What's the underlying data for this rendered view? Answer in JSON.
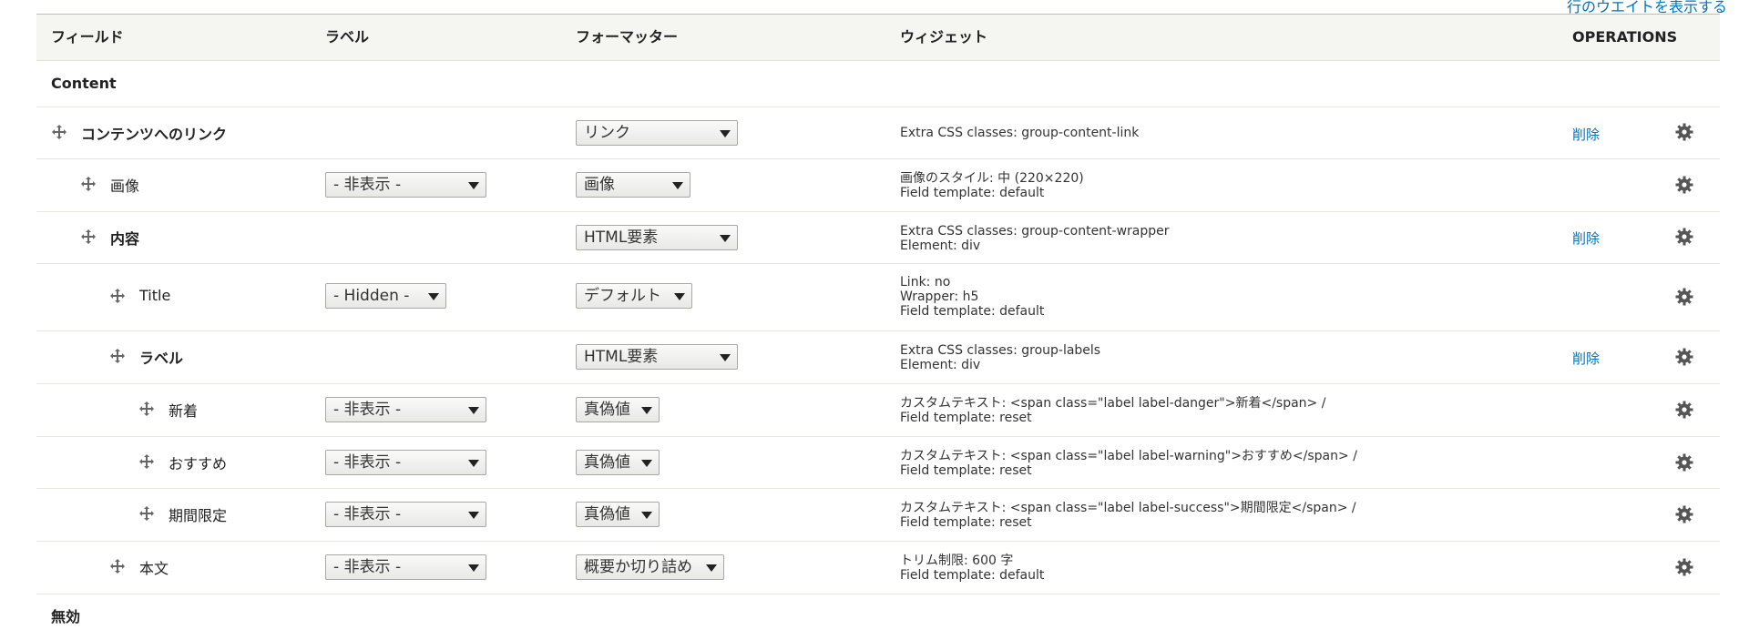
{
  "weights_link": "行のウエイトを表示する",
  "headers": {
    "field": "フィールド",
    "label": "ラベル",
    "formatter": "フォーマッター",
    "widget": "ウィジェット",
    "operations": "OPERATIONS"
  },
  "regions": {
    "content": "Content",
    "disabled": "無効"
  },
  "rows": [
    {
      "name": "コンテンツへのリンク",
      "bold": true,
      "indent": 0,
      "label_select": "",
      "formatter_select": "リンク",
      "widget_lines": [
        "Extra CSS classes: group-content-link"
      ],
      "op": "削除"
    },
    {
      "name": "画像",
      "bold": false,
      "indent": 1,
      "label_select": "- 非表示 -",
      "formatter_select": "画像",
      "widget_lines": [
        "画像のスタイル: 中 (220×220)",
        "Field template: default"
      ],
      "op": ""
    },
    {
      "name": "内容",
      "bold": true,
      "indent": 1,
      "label_select": "",
      "formatter_select": "HTML要素",
      "widget_lines": [
        "Extra CSS classes: group-content-wrapper",
        "Element: div"
      ],
      "op": "削除"
    },
    {
      "name": "Title",
      "bold": false,
      "indent": 2,
      "label_select": "- Hidden -",
      "formatter_select": "デフォルト",
      "widget_lines": [
        "Link: no",
        "Wrapper: h5",
        "Field template: default"
      ],
      "op": ""
    },
    {
      "name": "ラベル",
      "bold": true,
      "indent": 2,
      "label_select": "",
      "formatter_select": "HTML要素",
      "widget_lines": [
        "Extra CSS classes: group-labels",
        "Element: div"
      ],
      "op": "削除"
    },
    {
      "name": "新着",
      "bold": false,
      "indent": 3,
      "label_select": "- 非表示 -",
      "formatter_select": "真偽値",
      "widget_lines": [
        "カスタムテキスト: <span class=\"label label-danger\">新着</span> /",
        "Field template: reset"
      ],
      "op": ""
    },
    {
      "name": "おすすめ",
      "bold": false,
      "indent": 3,
      "label_select": "- 非表示 -",
      "formatter_select": "真偽値",
      "widget_lines": [
        "カスタムテキスト: <span class=\"label label-warning\">おすすめ</span> /",
        "Field template: reset"
      ],
      "op": ""
    },
    {
      "name": "期間限定",
      "bold": false,
      "indent": 3,
      "label_select": "- 非表示 -",
      "formatter_select": "真偽値",
      "widget_lines": [
        "カスタムテキスト: <span class=\"label label-success\">期間限定</span> /",
        "Field template: reset"
      ],
      "op": ""
    },
    {
      "name": "本文",
      "bold": false,
      "indent": 2,
      "label_select": "- 非表示 -",
      "formatter_select": "概要か切り詰め",
      "widget_lines": [
        "トリム制限: 600 字",
        "Field template: default"
      ],
      "op": ""
    }
  ],
  "icons": {
    "drag": "drag-handle-icon",
    "settings": "gear-icon",
    "dropdown": "chevron-down-icon"
  },
  "colors": {
    "link": "#0074bd",
    "header_bg": "#f5f5f2"
  }
}
